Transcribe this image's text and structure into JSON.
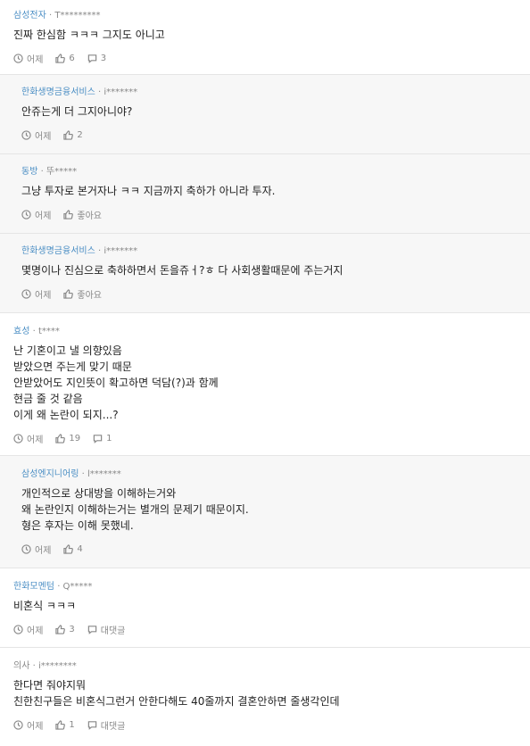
{
  "comments": [
    {
      "author": "삼성전자",
      "id": "T*********",
      "lines": [
        "진짜 한심함 ㅋㅋㅋ 그지도 아니고"
      ],
      "time": "어제",
      "likes": "6",
      "replies": "3"
    },
    {
      "author": "한화생명금융서비스",
      "id": "i*******",
      "lines": [
        "안쥬는게 더 그지아니야?"
      ],
      "time": "어제",
      "likes": "2"
    },
    {
      "author": "동방",
      "id": "뚜*****",
      "lines": [
        "그냥 투자로 본거자나 ㅋㅋ 지금까지 축하가 아니라 투자."
      ],
      "time": "어제",
      "likes": "좋아요"
    },
    {
      "author": "한화생명금융서비스",
      "id": "i*******",
      "lines": [
        "몇명이나 진심으로 축하하면서 돈을쥬ㅓ?ㅎ 다 사회생활때문에 주는거지"
      ],
      "time": "어제",
      "likes": "좋아요"
    },
    {
      "author": "효성",
      "id": "t****",
      "lines": [
        "난 기혼이고 낼 의향있음",
        "받았으면 주는게 맞기 때문",
        "안받았어도 지인뜻이 확고하면 덕담(?)과 함께",
        "현금 줄 것 같음",
        "이게 왜 논란이 되지...?"
      ],
      "time": "어제",
      "likes": "19",
      "replies": "1"
    },
    {
      "author": "삼성엔지니어링",
      "id": "l*******",
      "lines": [
        "개인적으로 상대방을 이해하는거와",
        "왜 논란인지 이해하는거는 별개의 문제기 때문이지.",
        "형은 후자는 이해 못했네."
      ],
      "time": "어제",
      "likes": "4"
    },
    {
      "author": "한화모멘텀",
      "id": "Q*****",
      "lines": [
        "비혼식 ㅋㅋㅋ"
      ],
      "time": "어제",
      "likes": "3",
      "replies": "대댓글"
    },
    {
      "author": "의사",
      "id": "i********",
      "lines": [
        "한다면 줘야지뭐",
        "친한친구들은 비혼식그런거 안한다해도 40줄까지 결혼안하면 줄생각인데"
      ],
      "time": "어제",
      "likes": "1",
      "replies": "대댓글"
    }
  ]
}
